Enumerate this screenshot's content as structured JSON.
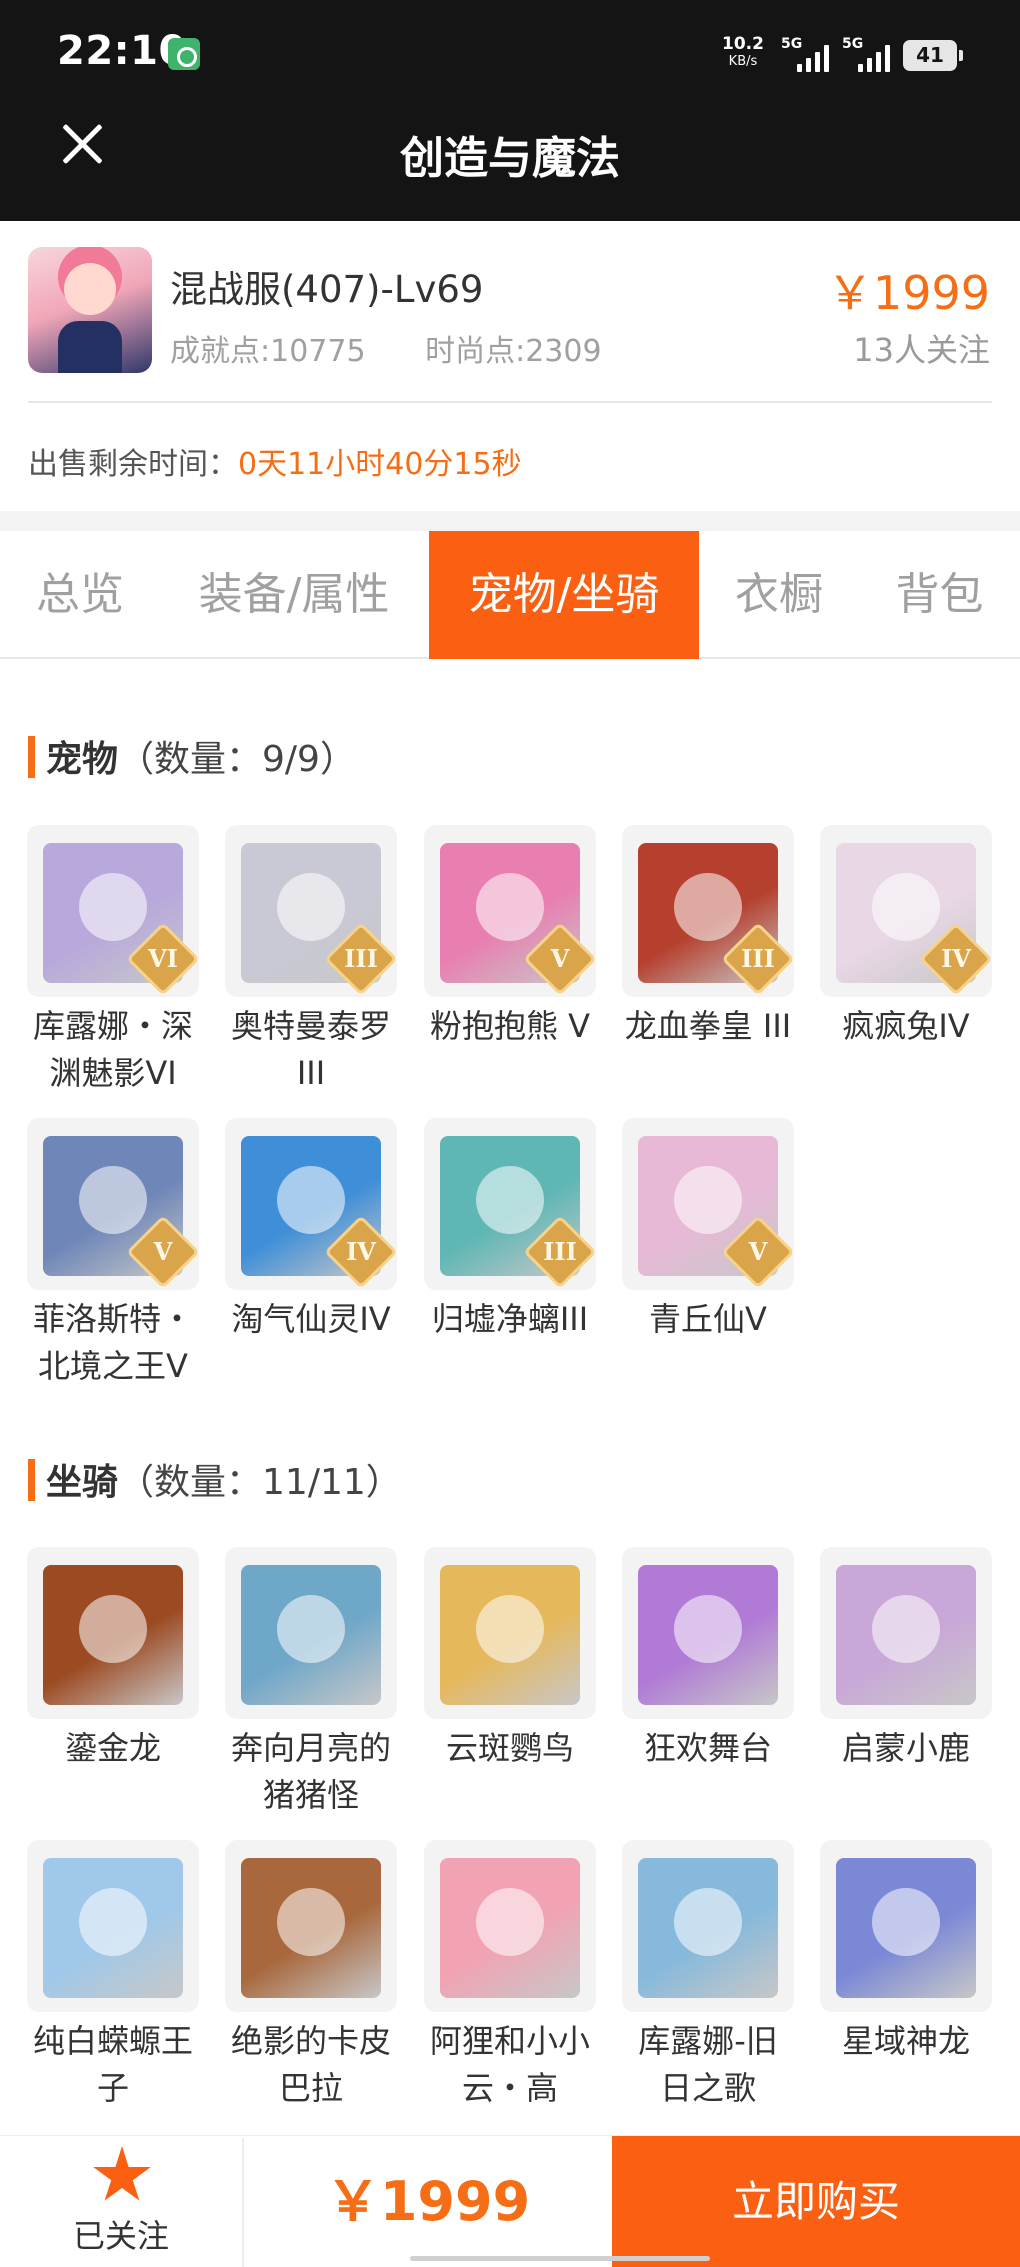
{
  "status_bar": {
    "time": "22:10",
    "net_speed": "10.2",
    "net_unit": "KB/s",
    "signal1": "5G",
    "signal2": "5G",
    "battery": "41"
  },
  "header": {
    "title": "创造与魔法",
    "close_icon": "close-icon"
  },
  "account": {
    "server_level": "混战服(407)-Lv69",
    "achievement": "成就点:10775",
    "fashion": "时尚点:2309",
    "price": "￥1999",
    "followers": "13人关注",
    "countdown_label": "出售剩余时间：",
    "countdown_value": "0天11小时40分15秒"
  },
  "tabs": [
    {
      "label": "总览"
    },
    {
      "label": "装备/属性"
    },
    {
      "label": "宠物/坐骑",
      "active": true
    },
    {
      "label": "衣橱"
    },
    {
      "label": "背包"
    }
  ],
  "pets": {
    "title": "宠物",
    "count": "（数量：9/9）",
    "items": [
      {
        "name": "库露娜・深\n渊魅影VI",
        "badge": "VI",
        "color": "#b8a8dc"
      },
      {
        "name": "奥特曼泰罗\nIII",
        "badge": "III",
        "color": "#c9c9d6"
      },
      {
        "name": "粉抱抱熊 V",
        "badge": "V",
        "color": "#e87fb0"
      },
      {
        "name": "龙血拳皇 III",
        "badge": "III",
        "color": "#b5402e"
      },
      {
        "name": "疯疯兔IV",
        "badge": "IV",
        "color": "#e9d7e6"
      },
      {
        "name": "菲洛斯特・\n北境之王V",
        "badge": "V",
        "color": "#6e86b8"
      },
      {
        "name": "淘气仙灵IV",
        "badge": "IV",
        "color": "#3f8fd8"
      },
      {
        "name": "归墟净螭III",
        "badge": "III",
        "color": "#5fb7b5"
      },
      {
        "name": "青丘仙V",
        "badge": "V",
        "color": "#e7b9d6"
      }
    ]
  },
  "mounts": {
    "title": "坐骑",
    "count": "（数量：11/11）",
    "items": [
      {
        "name": "鎏金龙",
        "color": "#9c4a22"
      },
      {
        "name": "奔向月亮的\n猪猪怪",
        "color": "#6fa7c9"
      },
      {
        "name": "云斑鹦鸟",
        "color": "#e6b85c"
      },
      {
        "name": "狂欢舞台",
        "color": "#b07ad6"
      },
      {
        "name": "启蒙小鹿",
        "color": "#c9a7d8"
      },
      {
        "name": "纯白蝾螈王\n子",
        "color": "#9fc8ea"
      },
      {
        "name": "绝影的卡皮\n巴拉",
        "color": "#a8673c"
      },
      {
        "name": "阿狸和小小\n云・高",
        "color": "#f1a3b3"
      },
      {
        "name": "库露娜-旧\n日之歌",
        "color": "#86b9dc"
      },
      {
        "name": "星域神龙",
        "color": "#7a88d6"
      }
    ]
  },
  "bottom_bar": {
    "follow_label": "已关注",
    "price": "￥1999",
    "buy_label": "立即购买"
  }
}
